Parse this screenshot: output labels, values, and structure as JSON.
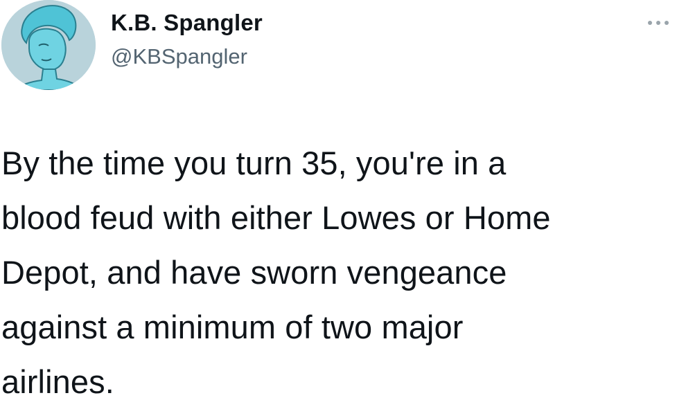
{
  "author": {
    "display_name": "K.B. Spangler",
    "handle": "@KBSpangler",
    "avatar_icon": "cartoon-portrait-avatar"
  },
  "menu": {
    "icon": "more-horizontal-icon"
  },
  "tweet": {
    "text": "By the time you turn 35, you're in a\nblood feud with either Lowes or Home\nDepot, and have sworn vengeance\nagainst a minimum of two major\nairlines."
  },
  "colors": {
    "text_primary": "#0f1419",
    "text_secondary": "#536471",
    "avatar_background": "#b9d3db",
    "avatar_figure": "#4fc3d6"
  }
}
